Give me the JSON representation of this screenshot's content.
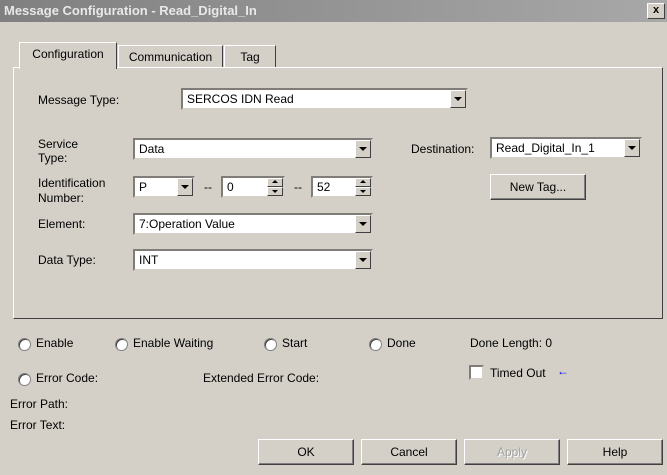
{
  "window": {
    "title": "Message Configuration - Read_Digital_In",
    "close_glyph": "x"
  },
  "tabs": [
    "Configuration",
    "Communication",
    "Tag"
  ],
  "config": {
    "message_type_label": "Message Type:",
    "message_type_value": "SERCOS IDN Read",
    "service_type_label_1": "Service",
    "service_type_label_2": "Type:",
    "service_type_value": "Data",
    "ident_label_1": "Identification",
    "ident_label_2": "Number:",
    "ident_prefix": "P",
    "ident_sep": "--",
    "ident_set": "0",
    "ident_number": "52",
    "element_label": "Element:",
    "element_value": "7:Operation Value",
    "data_type_label": "Data Type:",
    "data_type_value": "INT",
    "destination_label": "Destination:",
    "destination_value": "Read_Digital_In_1",
    "new_tag_label": "New Tag..."
  },
  "status": {
    "enable": "Enable",
    "enable_waiting": "Enable Waiting",
    "start": "Start",
    "done": "Done",
    "done_length": "Done Length: 0",
    "error_code": "Error Code:",
    "extended_error_code": "Extended Error Code:",
    "timed_out": "Timed Out",
    "timed_out_arrow": "←",
    "error_path": "Error Path:",
    "error_text": "Error Text:"
  },
  "buttons": {
    "ok": "OK",
    "cancel": "Cancel",
    "apply": "Apply",
    "help": "Help"
  },
  "colors": {
    "title_start": "#808080",
    "title_end": "#a8a8a8",
    "face": "#d4d0c8",
    "arrow": "#0000ff"
  }
}
